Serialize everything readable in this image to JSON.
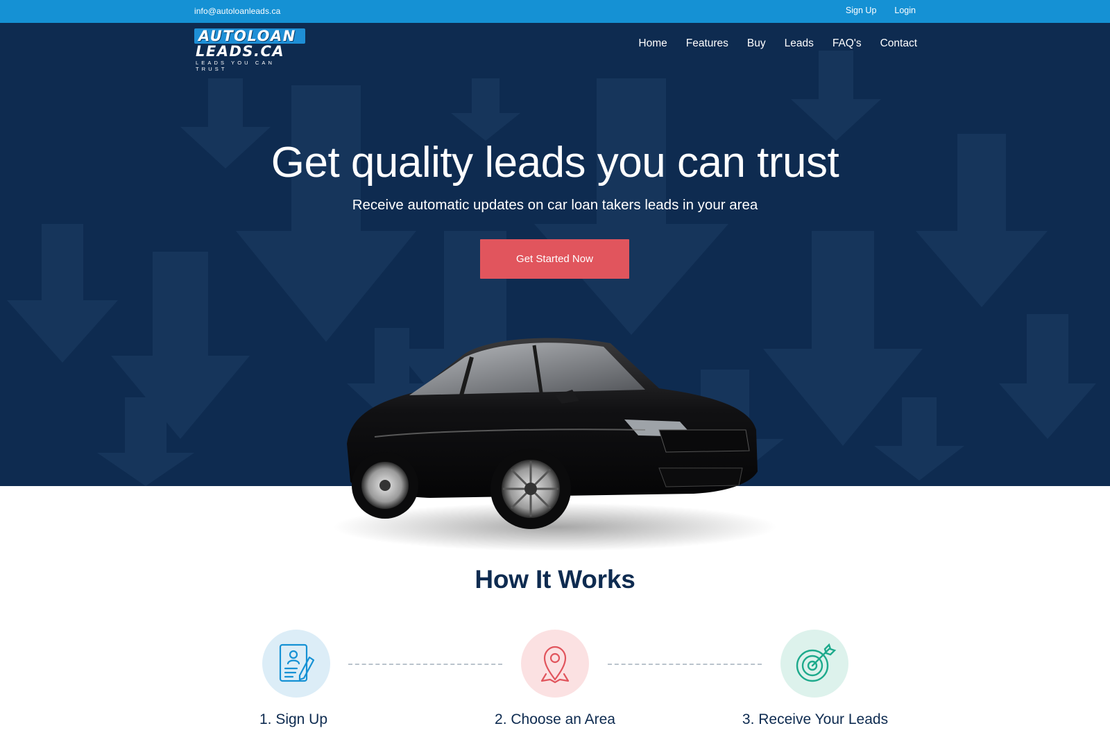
{
  "topbar": {
    "email": "info@autoloanleads.ca",
    "signup": "Sign Up",
    "login": "Login"
  },
  "logo": {
    "line1": "AUTOLOAN",
    "line2": "LEADS.CA",
    "tagline": "LEADS YOU CAN TRUST"
  },
  "nav": {
    "items": [
      "Home",
      "Features",
      "Buy",
      "Leads",
      "FAQ's",
      "Contact"
    ]
  },
  "hero": {
    "title": "Get quality leads you can trust",
    "subtitle": "Receive automatic updates on car loan takers leads in your area",
    "cta": "Get Started Now"
  },
  "how_it_works": {
    "title": "How It Works",
    "steps": [
      {
        "label": "1. Sign Up",
        "icon": "signup-form-icon",
        "color": "#1591d4",
        "bg": "#dcedf7"
      },
      {
        "label": "2. Choose an Area",
        "icon": "map-pin-icon",
        "color": "#e1555d",
        "bg": "#fbe1e2"
      },
      {
        "label": "3. Receive Your Leads",
        "icon": "target-icon",
        "color": "#1eaa8c",
        "bg": "#ddf2ec"
      }
    ]
  },
  "colors": {
    "topbar": "#1591d4",
    "hero_bg": "#0e2b50",
    "cta": "#e1555d",
    "heading": "#0e2b50"
  }
}
